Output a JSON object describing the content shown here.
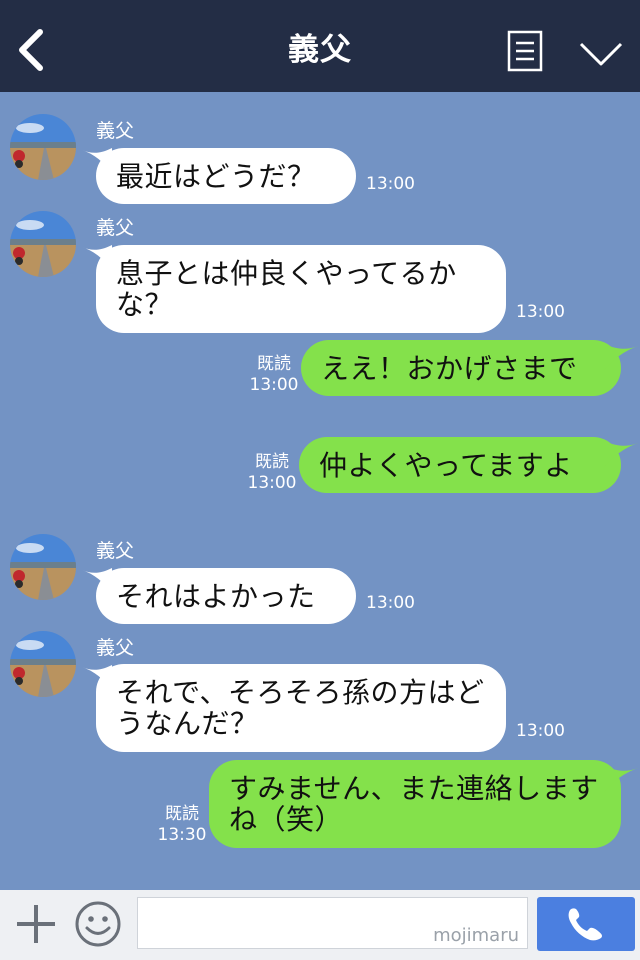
{
  "header": {
    "title": "義父"
  },
  "watermark": "mojimaru",
  "messages": [
    {
      "sender": "義父",
      "text": "最近はどうだ？",
      "time": "13:00"
    },
    {
      "sender": "義父",
      "text": "息子とは仲良くやってるかな？",
      "time": "13:00"
    },
    {
      "text": "ええ！おかげさまで",
      "read": "既読",
      "time": "13:00"
    },
    {
      "text": "仲よくやってますよ",
      "read": "既読",
      "time": "13:00"
    },
    {
      "sender": "義父",
      "text": "それはよかった",
      "time": "13:00"
    },
    {
      "sender": "義父",
      "text": "それで、そろそろ孫の方はどうなんだ？",
      "time": "13:00"
    },
    {
      "text": "すみません、また連絡しますね（笑）",
      "read": "既読",
      "time": "13:30"
    }
  ],
  "colors": {
    "header": "#232d45",
    "chat_bg": "#7393c4",
    "out_bubble": "#84e14b",
    "in_bubble": "#ffffff",
    "call": "#4b7fe0"
  },
  "icons": [
    "back-icon",
    "menu-icon",
    "chevron-down-icon",
    "plus-icon",
    "smile-icon",
    "phone-icon"
  ]
}
